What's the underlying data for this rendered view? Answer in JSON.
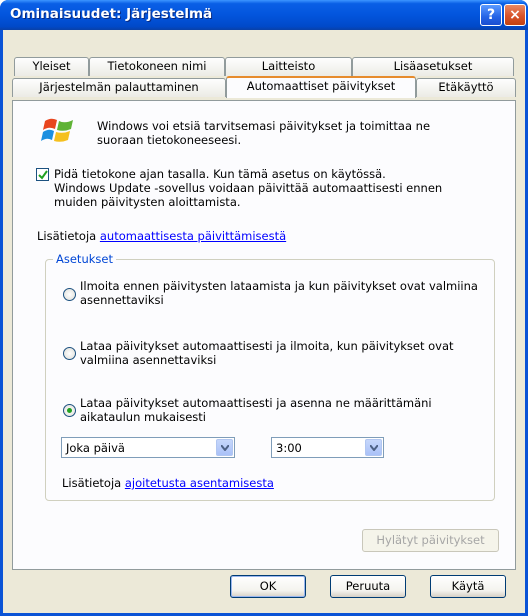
{
  "window": {
    "title": "Ominaisuudet: Järjestelmä",
    "help_label": "?",
    "close_label": "×"
  },
  "tabs": {
    "row1": [
      "Yleiset",
      "Tietokoneen nimi",
      "Laitteisto",
      "Lisäasetukset"
    ],
    "row2": [
      "Järjestelmän palauttaminen",
      "Automaattiset päivitykset",
      "Etäkäyttö"
    ],
    "active": "Automaattiset päivitykset"
  },
  "intro": {
    "line1": "Windows voi etsiä tarvitsemasi päivitykset ja toimittaa ne",
    "line2": "suoraan tietokoneeseesi."
  },
  "keep_updated": {
    "checked": true,
    "line1": "Pidä tietokone ajan tasalla. Kun tämä asetus on käytössä.",
    "line2": "Windows Update -sovellus voidaan päivittää automaattisesti ennen",
    "line3": "muiden päivitysten aloittamista."
  },
  "more_info": {
    "prefix": "Lisätietoja",
    "link": "automaattisesta päivittämisestä"
  },
  "settings": {
    "label": "Asetukset",
    "options": [
      {
        "line1": "Ilmoita ennen päivitysten lataamista ja kun päivitykset ovat valmiina",
        "line2": "asennettaviksi",
        "selected": false
      },
      {
        "line1": "Lataa päivitykset automaattisesti ja ilmoita, kun päivitykset ovat",
        "line2": "valmiina asennettaviksi",
        "selected": false
      },
      {
        "line1": "Lataa päivitykset automaattisesti ja asenna ne määrittämäni",
        "line2": "aikataulun mukaisesti",
        "selected": true
      }
    ],
    "day_value": "Joka päivä",
    "time_value": "3:00",
    "schedule_info_prefix": "Lisätietoja",
    "schedule_info_link": "ajoitetusta asentamisesta"
  },
  "declined_button": "Hylätyt päivitykset",
  "buttons": {
    "ok": "OK",
    "cancel": "Peruuta",
    "apply": "Käytä"
  }
}
